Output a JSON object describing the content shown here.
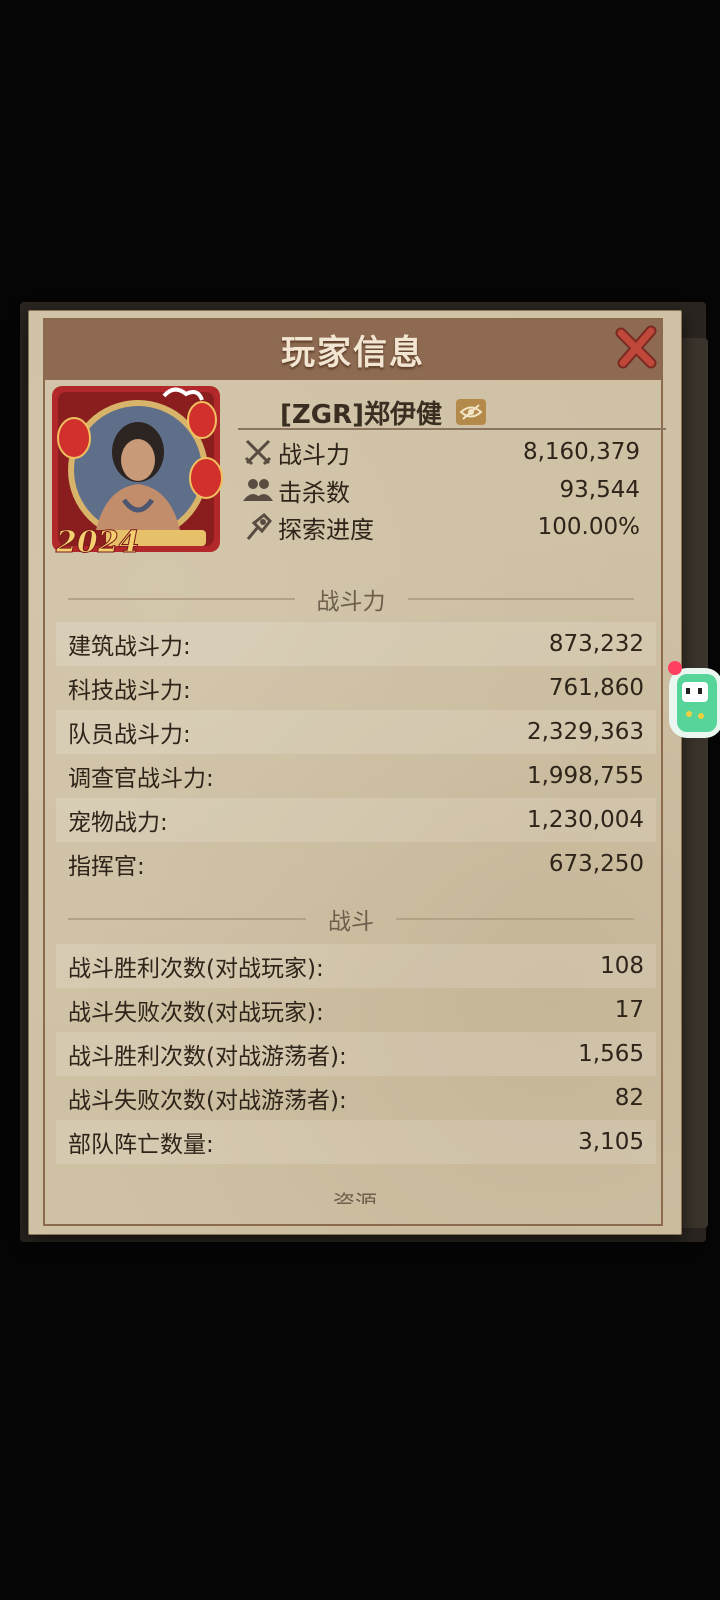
{
  "title": "玩家信息",
  "player": {
    "name": "[ZGR]郑伊健",
    "avatar_year": "2024"
  },
  "top_stats": [
    {
      "icon": "crossed-swords-icon",
      "label": "战斗力",
      "value": "8,160,379"
    },
    {
      "icon": "people-icon",
      "label": "击杀数",
      "value": "93,544"
    },
    {
      "icon": "exploration-icon",
      "label": "探索进度",
      "value": "100.00%"
    }
  ],
  "sections": [
    {
      "header": "战斗力",
      "rows": [
        {
          "label": "建筑战斗力:",
          "value": "873,232"
        },
        {
          "label": "科技战斗力:",
          "value": "761,860"
        },
        {
          "label": "队员战斗力:",
          "value": "2,329,363"
        },
        {
          "label": "调查官战斗力:",
          "value": "1,998,755"
        },
        {
          "label": "宠物战力:",
          "value": "1,230,004"
        },
        {
          "label": "指挥官:",
          "value": "673,250"
        }
      ]
    },
    {
      "header": "战斗",
      "rows": [
        {
          "label": "战斗胜利次数(对战玩家):",
          "value": "108"
        },
        {
          "label": "战斗失败次数(对战玩家):",
          "value": "17"
        },
        {
          "label": "战斗胜利次数(对战游荡者):",
          "value": "1,565"
        },
        {
          "label": "战斗失败次数(对战游荡者):",
          "value": "82"
        },
        {
          "label": "部队阵亡数量:",
          "value": "3,105"
        }
      ]
    },
    {
      "header": "资源",
      "rows": []
    }
  ],
  "colors": {
    "title_bar": "#8d6a51",
    "panel": "#cfc1a4",
    "close_x": "#c0483a"
  }
}
